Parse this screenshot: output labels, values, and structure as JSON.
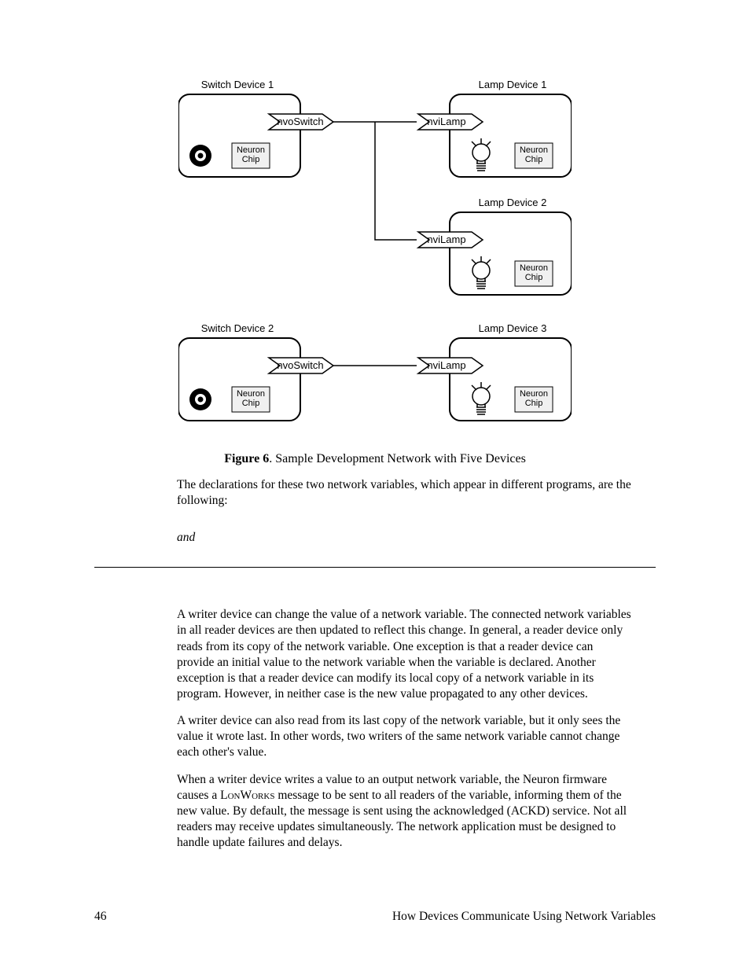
{
  "diagram": {
    "devices": {
      "switch1": "Switch Device 1",
      "switch2": "Switch Device 2",
      "lamp1": "Lamp Device 1",
      "lamp2": "Lamp Device 2",
      "lamp3": "Lamp Device 3"
    },
    "nv": {
      "out": "nvoSwitch",
      "in": "nviLamp"
    },
    "chip": "Neuron\nChip"
  },
  "figure": {
    "label": "Figure 6",
    "caption": ". Sample Development Network with Five Devices"
  },
  "intro": "The declarations for these two network variables, which appear in different programs, are the following:",
  "and": "and",
  "paras": {
    "p1": "A writer device can change the value of a network variable.  The connected network variables in all reader devices are then updated to reflect this change.  In general, a reader device only reads from its copy of the network variable.  One exception is that a reader device can provide an initial value to the network variable when the variable is declared.  Another exception is that a reader device can modify its local copy of a network variable in its program.  However, in neither case is the new value propagated to any other devices.",
    "p2": "A writer device can also read from its last copy of the network variable, but it only sees the value it wrote last.  In other words, two writers of the same network variable cannot change each other's value.",
    "p3a": "When a writer device writes a value to an output network variable, the Neuron firmware causes a L",
    "p3b": "on",
    "p3c": "W",
    "p3d": "orks",
    "p3e": " message to be sent to all readers of the variable, informing them of the new value.  By default, the message is sent using the acknowledged (ACKD) service.  Not all readers may receive updates simultaneously.  The network application must be designed to handle update failures and delays."
  },
  "footer": {
    "page": "46",
    "chapter": "How Devices Communicate Using Network Variables"
  }
}
